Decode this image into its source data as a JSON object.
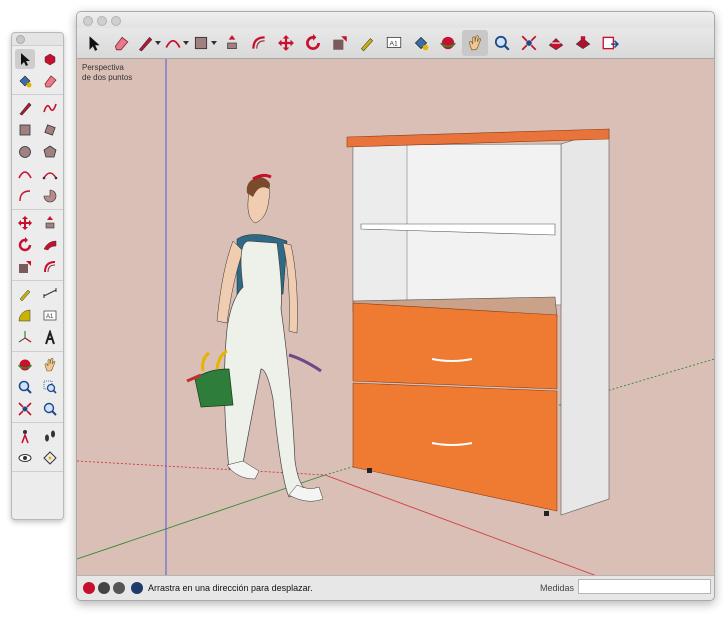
{
  "viewport": {
    "scene_label": "Perspectiva\nde dos puntos",
    "background": "#d9bfb6"
  },
  "toolbar": {
    "items": [
      {
        "icon": "select-icon"
      },
      {
        "icon": "eraser-icon"
      },
      {
        "icon": "pencil-line-icon",
        "has_menu": true
      },
      {
        "icon": "arc-icon",
        "has_menu": true
      },
      {
        "icon": "rectangle-icon",
        "has_menu": true
      },
      {
        "icon": "push-pull-icon"
      },
      {
        "icon": "offset-icon"
      },
      {
        "icon": "move-icon"
      },
      {
        "icon": "rotate-icon"
      },
      {
        "icon": "scale-icon"
      },
      {
        "icon": "tape-measure-icon"
      },
      {
        "icon": "text-icon"
      },
      {
        "icon": "paint-bucket-icon"
      },
      {
        "icon": "orbit-icon"
      },
      {
        "icon": "pan-hand-icon",
        "active": true
      },
      {
        "icon": "zoom-icon"
      },
      {
        "icon": "zoom-extents-icon"
      },
      {
        "icon": "warehouse-icon"
      },
      {
        "icon": "extension-warehouse-icon"
      },
      {
        "icon": "send-to-layout-icon"
      }
    ]
  },
  "palette": {
    "groups": [
      [
        [
          "select-icon",
          "component-icon"
        ],
        [
          "paint-bucket-icon",
          "eraser-icon"
        ]
      ],
      [
        [
          "pencil-line-icon",
          "freehand-icon"
        ],
        [
          "rectangle-icon",
          "rotated-rectangle-icon"
        ],
        [
          "circle-icon",
          "polygon-icon"
        ],
        [
          "arc-icon",
          "two-point-arc-icon"
        ],
        [
          "three-point-arc-icon",
          "pie-icon"
        ]
      ],
      [
        [
          "move-icon",
          "push-pull-icon"
        ],
        [
          "rotate-icon",
          "follow-me-icon"
        ],
        [
          "scale-icon",
          "offset-icon"
        ]
      ],
      [
        [
          "tape-measure-icon",
          "dimension-icon"
        ],
        [
          "protractor-icon",
          "text-icon"
        ],
        [
          "axes-icon",
          "3d-text-icon"
        ]
      ],
      [
        [
          "orbit-icon",
          "pan-hand-icon"
        ],
        [
          "zoom-icon",
          "zoom-window-icon"
        ],
        [
          "zoom-extents-icon",
          "previous-view-icon"
        ]
      ],
      [
        [
          "position-camera-icon",
          "walk-icon"
        ],
        [
          "look-around-icon",
          "section-plane-icon"
        ]
      ]
    ],
    "active": "select-icon"
  },
  "statusbar": {
    "icons": [
      "geo-location-icon",
      "credits-icon",
      "user-account-icon",
      "pan-tool-status-icon"
    ],
    "hint": "Arrastra en una dirección para desplazar.",
    "measures_label": "Medidas",
    "measures_value": ""
  },
  "colors": {
    "accent_red": "#c8102e",
    "cabinet_top": "#e8743c",
    "drawer_front": "#ef7b33",
    "cabinet_white": "#f2f2f2",
    "axis_red": "#d23a3a",
    "axis_green": "#2f8a2f",
    "axis_blue": "#4a4ad0"
  }
}
